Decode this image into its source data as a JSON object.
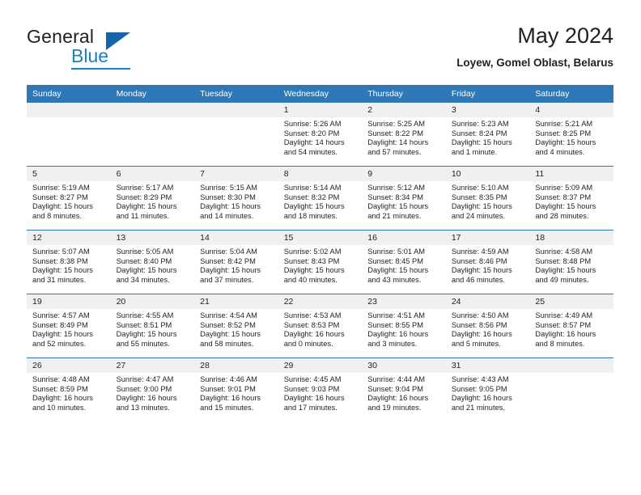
{
  "brand": {
    "name_part1": "General",
    "name_part2": "Blue",
    "logo_icon": "triangle-icon"
  },
  "header": {
    "title": "May 2024",
    "location": "Loyew, Gomel Oblast, Belarus"
  },
  "colors": {
    "header_blue": "#2E78B8",
    "brand_blue": "#1A7FC1",
    "daynum_band": "#F0F0F0",
    "text": "#231F20"
  },
  "calendar": {
    "weekday_headers": [
      "Sunday",
      "Monday",
      "Tuesday",
      "Wednesday",
      "Thursday",
      "Friday",
      "Saturday"
    ],
    "weeks": [
      [
        {
          "day": "",
          "empty": true
        },
        {
          "day": "",
          "empty": true
        },
        {
          "day": "",
          "empty": true
        },
        {
          "day": "1",
          "sunrise": "Sunrise: 5:26 AM",
          "sunset": "Sunset: 8:20 PM",
          "daylight1": "Daylight: 14 hours",
          "daylight2": "and 54 minutes."
        },
        {
          "day": "2",
          "sunrise": "Sunrise: 5:25 AM",
          "sunset": "Sunset: 8:22 PM",
          "daylight1": "Daylight: 14 hours",
          "daylight2": "and 57 minutes."
        },
        {
          "day": "3",
          "sunrise": "Sunrise: 5:23 AM",
          "sunset": "Sunset: 8:24 PM",
          "daylight1": "Daylight: 15 hours",
          "daylight2": "and 1 minute."
        },
        {
          "day": "4",
          "sunrise": "Sunrise: 5:21 AM",
          "sunset": "Sunset: 8:25 PM",
          "daylight1": "Daylight: 15 hours",
          "daylight2": "and 4 minutes."
        }
      ],
      [
        {
          "day": "5",
          "sunrise": "Sunrise: 5:19 AM",
          "sunset": "Sunset: 8:27 PM",
          "daylight1": "Daylight: 15 hours",
          "daylight2": "and 8 minutes."
        },
        {
          "day": "6",
          "sunrise": "Sunrise: 5:17 AM",
          "sunset": "Sunset: 8:29 PM",
          "daylight1": "Daylight: 15 hours",
          "daylight2": "and 11 minutes."
        },
        {
          "day": "7",
          "sunrise": "Sunrise: 5:15 AM",
          "sunset": "Sunset: 8:30 PM",
          "daylight1": "Daylight: 15 hours",
          "daylight2": "and 14 minutes."
        },
        {
          "day": "8",
          "sunrise": "Sunrise: 5:14 AM",
          "sunset": "Sunset: 8:32 PM",
          "daylight1": "Daylight: 15 hours",
          "daylight2": "and 18 minutes."
        },
        {
          "day": "9",
          "sunrise": "Sunrise: 5:12 AM",
          "sunset": "Sunset: 8:34 PM",
          "daylight1": "Daylight: 15 hours",
          "daylight2": "and 21 minutes."
        },
        {
          "day": "10",
          "sunrise": "Sunrise: 5:10 AM",
          "sunset": "Sunset: 8:35 PM",
          "daylight1": "Daylight: 15 hours",
          "daylight2": "and 24 minutes."
        },
        {
          "day": "11",
          "sunrise": "Sunrise: 5:09 AM",
          "sunset": "Sunset: 8:37 PM",
          "daylight1": "Daylight: 15 hours",
          "daylight2": "and 28 minutes."
        }
      ],
      [
        {
          "day": "12",
          "sunrise": "Sunrise: 5:07 AM",
          "sunset": "Sunset: 8:38 PM",
          "daylight1": "Daylight: 15 hours",
          "daylight2": "and 31 minutes."
        },
        {
          "day": "13",
          "sunrise": "Sunrise: 5:05 AM",
          "sunset": "Sunset: 8:40 PM",
          "daylight1": "Daylight: 15 hours",
          "daylight2": "and 34 minutes."
        },
        {
          "day": "14",
          "sunrise": "Sunrise: 5:04 AM",
          "sunset": "Sunset: 8:42 PM",
          "daylight1": "Daylight: 15 hours",
          "daylight2": "and 37 minutes."
        },
        {
          "day": "15",
          "sunrise": "Sunrise: 5:02 AM",
          "sunset": "Sunset: 8:43 PM",
          "daylight1": "Daylight: 15 hours",
          "daylight2": "and 40 minutes."
        },
        {
          "day": "16",
          "sunrise": "Sunrise: 5:01 AM",
          "sunset": "Sunset: 8:45 PM",
          "daylight1": "Daylight: 15 hours",
          "daylight2": "and 43 minutes."
        },
        {
          "day": "17",
          "sunrise": "Sunrise: 4:59 AM",
          "sunset": "Sunset: 8:46 PM",
          "daylight1": "Daylight: 15 hours",
          "daylight2": "and 46 minutes."
        },
        {
          "day": "18",
          "sunrise": "Sunrise: 4:58 AM",
          "sunset": "Sunset: 8:48 PM",
          "daylight1": "Daylight: 15 hours",
          "daylight2": "and 49 minutes."
        }
      ],
      [
        {
          "day": "19",
          "sunrise": "Sunrise: 4:57 AM",
          "sunset": "Sunset: 8:49 PM",
          "daylight1": "Daylight: 15 hours",
          "daylight2": "and 52 minutes."
        },
        {
          "day": "20",
          "sunrise": "Sunrise: 4:55 AM",
          "sunset": "Sunset: 8:51 PM",
          "daylight1": "Daylight: 15 hours",
          "daylight2": "and 55 minutes."
        },
        {
          "day": "21",
          "sunrise": "Sunrise: 4:54 AM",
          "sunset": "Sunset: 8:52 PM",
          "daylight1": "Daylight: 15 hours",
          "daylight2": "and 58 minutes."
        },
        {
          "day": "22",
          "sunrise": "Sunrise: 4:53 AM",
          "sunset": "Sunset: 8:53 PM",
          "daylight1": "Daylight: 16 hours",
          "daylight2": "and 0 minutes."
        },
        {
          "day": "23",
          "sunrise": "Sunrise: 4:51 AM",
          "sunset": "Sunset: 8:55 PM",
          "daylight1": "Daylight: 16 hours",
          "daylight2": "and 3 minutes."
        },
        {
          "day": "24",
          "sunrise": "Sunrise: 4:50 AM",
          "sunset": "Sunset: 8:56 PM",
          "daylight1": "Daylight: 16 hours",
          "daylight2": "and 5 minutes."
        },
        {
          "day": "25",
          "sunrise": "Sunrise: 4:49 AM",
          "sunset": "Sunset: 8:57 PM",
          "daylight1": "Daylight: 16 hours",
          "daylight2": "and 8 minutes."
        }
      ],
      [
        {
          "day": "26",
          "sunrise": "Sunrise: 4:48 AM",
          "sunset": "Sunset: 8:59 PM",
          "daylight1": "Daylight: 16 hours",
          "daylight2": "and 10 minutes."
        },
        {
          "day": "27",
          "sunrise": "Sunrise: 4:47 AM",
          "sunset": "Sunset: 9:00 PM",
          "daylight1": "Daylight: 16 hours",
          "daylight2": "and 13 minutes."
        },
        {
          "day": "28",
          "sunrise": "Sunrise: 4:46 AM",
          "sunset": "Sunset: 9:01 PM",
          "daylight1": "Daylight: 16 hours",
          "daylight2": "and 15 minutes."
        },
        {
          "day": "29",
          "sunrise": "Sunrise: 4:45 AM",
          "sunset": "Sunset: 9:03 PM",
          "daylight1": "Daylight: 16 hours",
          "daylight2": "and 17 minutes."
        },
        {
          "day": "30",
          "sunrise": "Sunrise: 4:44 AM",
          "sunset": "Sunset: 9:04 PM",
          "daylight1": "Daylight: 16 hours",
          "daylight2": "and 19 minutes."
        },
        {
          "day": "31",
          "sunrise": "Sunrise: 4:43 AM",
          "sunset": "Sunset: 9:05 PM",
          "daylight1": "Daylight: 16 hours",
          "daylight2": "and 21 minutes."
        },
        {
          "day": "",
          "empty": true
        }
      ]
    ]
  }
}
